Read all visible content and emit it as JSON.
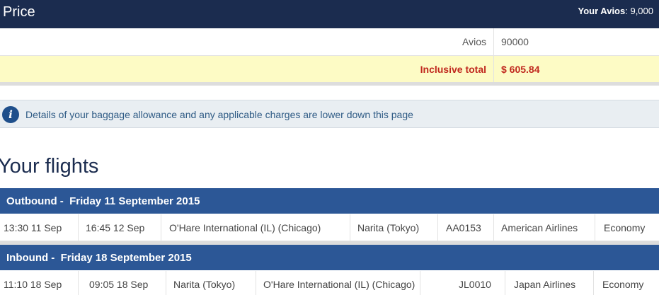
{
  "price": {
    "title": "Price",
    "your_avios_label": "Your Avios",
    "your_avios_value": ": 9,000",
    "avios_label": "Avios",
    "avios_value": "90000",
    "total_label": "Inclusive total",
    "total_value": "$ 605.84"
  },
  "info": {
    "icon": "info-icon",
    "glyph": "i",
    "text": "Details of your baggage allowance and any applicable charges are lower down this page"
  },
  "flights": {
    "title": "Your flights",
    "outbound": {
      "label": "Outbound -  Friday 11 September 2015",
      "depart": "13:30 11 Sep",
      "arrive": "16:45 12 Sep",
      "from": "O'Hare International (IL) (Chicago)",
      "to": "Narita (Tokyo)",
      "flight": "AA0153",
      "airline": "American Airlines",
      "cabin": "Economy"
    },
    "inbound": {
      "label": "Inbound -  Friday 18 September 2015",
      "depart": "11:10 18 Sep",
      "arrive": "09:05 18 Sep",
      "from": "Narita (Tokyo)",
      "to": "O'Hare International (IL) (Chicago)",
      "flight": "JL0010",
      "airline": "Japan Airlines",
      "cabin": "Economy"
    }
  },
  "colors": {
    "header_bg": "#1b2c4f",
    "section_bar": "#2c5796",
    "total_text": "#c0281e",
    "total_bg": "#fdfbc5"
  }
}
